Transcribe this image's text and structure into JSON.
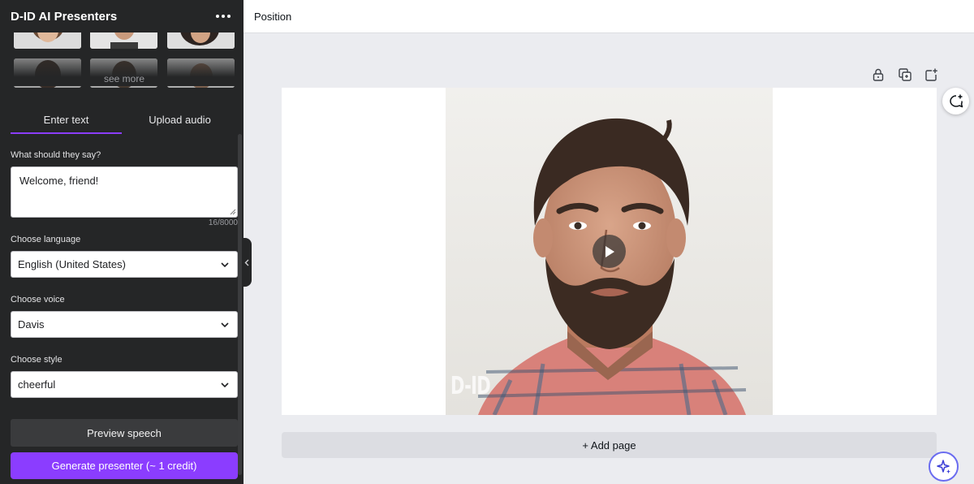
{
  "panel": {
    "title": "D-ID AI Presenters",
    "more_icon": "more-horizontal-icon",
    "see_more": "see more",
    "tabs": [
      {
        "label": "Enter text",
        "active": true
      },
      {
        "label": "Upload audio",
        "active": false
      }
    ],
    "speech": {
      "label": "What should they say?",
      "value": "Welcome, friend!",
      "counter": "16/8000"
    },
    "language": {
      "label": "Choose language",
      "value": "English (United States)"
    },
    "voice": {
      "label": "Choose voice",
      "value": "Davis"
    },
    "style": {
      "label": "Choose style",
      "value": "cheerful"
    },
    "preview_button": "Preview speech",
    "generate_button": "Generate presenter (~ 1 credit)"
  },
  "topbar": {
    "position_label": "Position"
  },
  "page": {
    "watermark": "D-ID",
    "tools": [
      "lock-icon",
      "duplicate-page-icon",
      "add-page-icon"
    ]
  },
  "add_page_label": "+ Add page",
  "colors": {
    "accent": "#8b3dff",
    "panel_bg": "#252627",
    "canvas_bg": "#ebecf0"
  }
}
